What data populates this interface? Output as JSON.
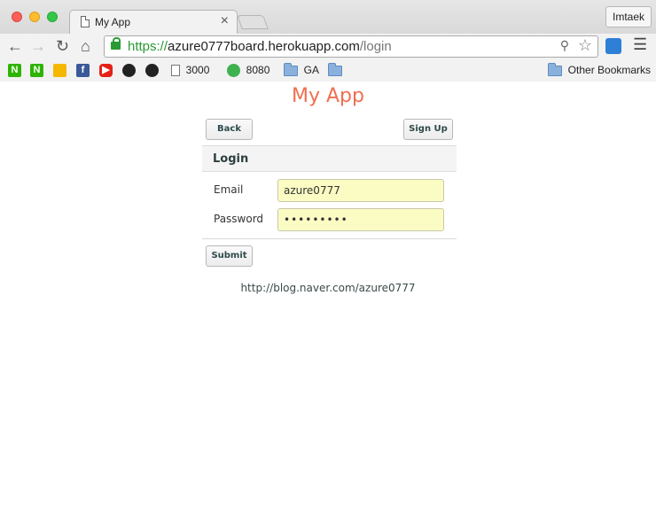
{
  "browser": {
    "tab_title": "My App",
    "tab_close": "×",
    "profile_name": "Imtaek",
    "url_scheme": "https://",
    "url_host": "azure0777board.herokuapp.com",
    "url_path": "/login",
    "bookmarks": {
      "n1": "N",
      "n2": "N",
      "b3000": "3000",
      "b8080": "8080",
      "ga": "GA",
      "other": "Other Bookmarks"
    }
  },
  "page": {
    "app_title": "My App",
    "back_label": "Back",
    "signup_label": "Sign Up",
    "panel_title": "Login",
    "email_label": "Email",
    "email_value": "azure0777",
    "password_label": "Password",
    "password_value": "•••••••••",
    "submit_label": "Submit",
    "footer_link": "http://blog.naver.com/azure0777"
  },
  "colors": {
    "title": "#f06f4f",
    "autofill": "#fbfcc4",
    "secure_green": "#2a9a34"
  }
}
